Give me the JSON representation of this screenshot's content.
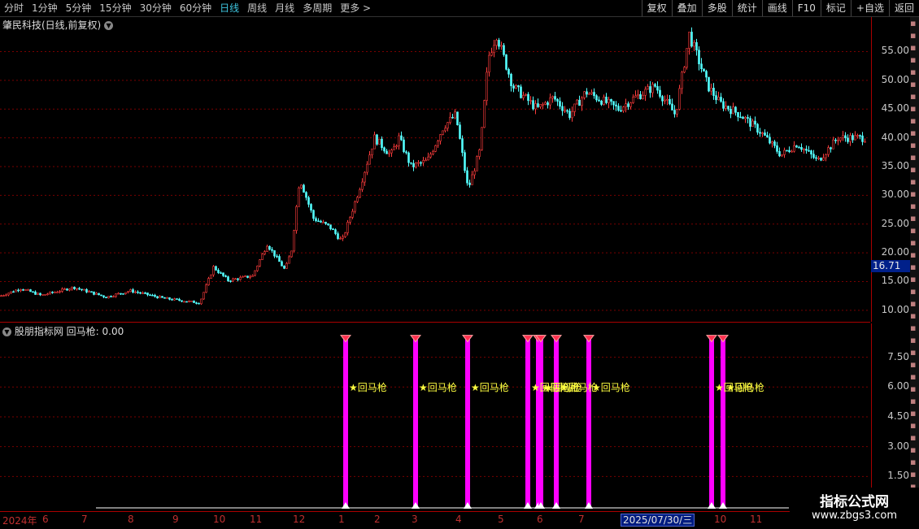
{
  "toolbar": {
    "periods": [
      "分时",
      "1分钟",
      "5分钟",
      "15分钟",
      "30分钟",
      "60分钟",
      "日线",
      "周线",
      "月线",
      "多周期",
      "更多 >"
    ],
    "active": "日线",
    "right_buttons": [
      "复权",
      "叠加",
      "多股",
      "统计",
      "画线",
      "F10",
      "标记",
      "+自选",
      "返回"
    ]
  },
  "main_title": "肇民科技(日线,前复权)",
  "sub_title": "股朋指标网  回马枪: 0.00",
  "price_tag": "16.71",
  "main_axis": [
    "55.00",
    "50.00",
    "45.00",
    "40.00",
    "35.00",
    "30.00",
    "25.00",
    "20.00",
    "15.00",
    "10.00"
  ],
  "sub_axis": [
    "7.50",
    "6.00",
    "4.50",
    "3.00",
    "1.50"
  ],
  "date_axis": [
    "2024年",
    "6",
    "7",
    "8",
    "9",
    "10",
    "11",
    "12",
    "1",
    "2",
    "3",
    "4",
    "5",
    "6",
    "7",
    "10",
    "11"
  ],
  "date_highlight": "2025/07/30/三",
  "signal_label": "★回马枪",
  "watermark": {
    "line1": "指标公式网",
    "line2": "www.zbgs3.com"
  },
  "colors": {
    "up": "#ff3c3c",
    "down": "#54ffff",
    "signal": "#ff00ff",
    "grid": "#7a0000",
    "active": "#3ec6e0"
  },
  "chart_data": {
    "type": "candlestick",
    "title": "肇民科技(日线,前复权)",
    "ylim": [
      8,
      61
    ],
    "price_path": [
      [
        0,
        12.5
      ],
      [
        25,
        13.8
      ],
      [
        50,
        12.6
      ],
      [
        90,
        14.0
      ],
      [
        130,
        12.3
      ],
      [
        160,
        13.4
      ],
      [
        200,
        12.1
      ],
      [
        245,
        11.3
      ],
      [
        262,
        17.5
      ],
      [
        280,
        15.2
      ],
      [
        310,
        16.0
      ],
      [
        328,
        21.5
      ],
      [
        350,
        17.0
      ],
      [
        358,
        20.5
      ],
      [
        368,
        33.0
      ],
      [
        385,
        26.0
      ],
      [
        405,
        24.5
      ],
      [
        420,
        22.0
      ],
      [
        440,
        30.5
      ],
      [
        460,
        40.0
      ],
      [
        480,
        37.0
      ],
      [
        490,
        40.0
      ],
      [
        505,
        35.0
      ],
      [
        525,
        36.0
      ],
      [
        545,
        42.0
      ],
      [
        560,
        44.0
      ],
      [
        575,
        31.0
      ],
      [
        590,
        38.0
      ],
      [
        600,
        54.0
      ],
      [
        610,
        58.0
      ],
      [
        630,
        49.0
      ],
      [
        660,
        45.0
      ],
      [
        680,
        47.0
      ],
      [
        700,
        44.0
      ],
      [
        720,
        48.0
      ],
      [
        760,
        45.0
      ],
      [
        780,
        47.0
      ],
      [
        805,
        49.0
      ],
      [
        830,
        44.0
      ],
      [
        847,
        58.0
      ],
      [
        870,
        49.0
      ],
      [
        885,
        46.0
      ],
      [
        910,
        44.0
      ],
      [
        935,
        41.0
      ],
      [
        960,
        37.0
      ],
      [
        980,
        39.0
      ],
      [
        1005,
        36.0
      ],
      [
        1030,
        40.0
      ],
      [
        1060,
        40.0
      ]
    ],
    "signals": {
      "indicator": "回马枪",
      "x": [
        425,
        511,
        575,
        649,
        662,
        665,
        684,
        724,
        875,
        889
      ],
      "value": 8.4,
      "label_value": 6.0
    }
  }
}
